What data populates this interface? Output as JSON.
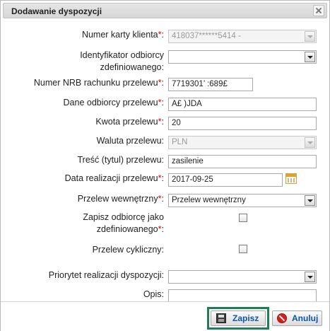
{
  "dialog": {
    "title": "Dodawanie dyspozycji"
  },
  "form": {
    "card_number": {
      "label": "Numer karty klienta",
      "value": "418037******5414 -"
    },
    "beneficiary_id": {
      "label_line1": "Identyfikator odbiorcy",
      "label_line2": "zdefiniowanego:",
      "value": ""
    },
    "nrb": {
      "label": "Numer NRB rachunku przelewu",
      "value": "7719301’               :689£"
    },
    "recipient": {
      "label": "Dane odbiorcy przelewu",
      "value": "A£                 )JDA"
    },
    "amount": {
      "label": "Kwota przelewu",
      "value": "20"
    },
    "currency": {
      "label": "Waluta przelewu:",
      "value": "PLN"
    },
    "title": {
      "label": "Treść (tytul) przelewu:",
      "value": "zasilenie"
    },
    "date": {
      "label": "Data realizacji przelewu",
      "value": "2017-09-25"
    },
    "internal": {
      "label": "Przelew wewnętrzny",
      "value": "Przelew wewnętrzny"
    },
    "save_beneficiary": {
      "label_line1": "Zapisz odbiorcę jako",
      "label_line2": "zdefiniowanego",
      "checked": false
    },
    "cyclic": {
      "label": "Przelew cykliczny:",
      "checked": false
    },
    "priority": {
      "label": "Priorytet realizacji dyspozycji:",
      "value": ""
    },
    "notes": {
      "label": "Opis:",
      "value": ""
    }
  },
  "required_marker": "*",
  "colon": ":",
  "buttons": {
    "save": "Zapisz",
    "cancel": "Anuluj"
  },
  "icons": [
    "close-icon",
    "dropdown-arrow-icon",
    "calendar-icon",
    "save-icon",
    "cancel-icon"
  ],
  "colors": {
    "required": "#cc0000",
    "button_text": "#0d56a6",
    "focus_frame": "#1e7f57"
  }
}
